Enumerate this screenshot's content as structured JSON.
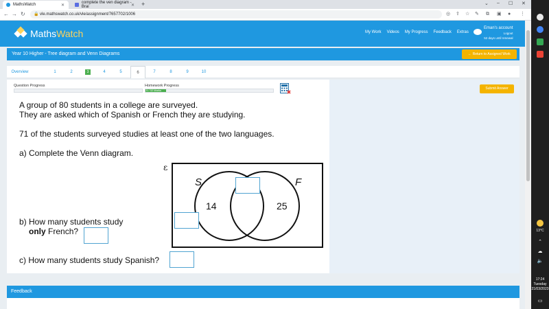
{
  "browser": {
    "tabs": [
      {
        "label": "MathsWatch",
        "active": true
      },
      {
        "label": "complete the ven diagram - Brai",
        "active": false
      }
    ],
    "url": "vle.mathswatch.co.uk/vle/assignment/7657702/1006"
  },
  "header": {
    "logo_maths": "Maths",
    "logo_watch": "Watch",
    "nav": [
      "My Work",
      "Videos",
      "My Progress",
      "Feedback",
      "Extras"
    ],
    "account_name": "Eman's account",
    "logout": "Logout",
    "days": "52 days until renewal"
  },
  "titlebar": {
    "title": "Year 10 Higher - Tree diagram and Venn Diagrams",
    "return_label": "← Return to Assigned Work"
  },
  "question_nav": {
    "overview": "Overview",
    "tabs": [
      "1",
      "2",
      "3",
      "4",
      "5",
      "6",
      "7",
      "8",
      "9",
      "10"
    ],
    "active_tab": "6",
    "completed_tab": "3"
  },
  "progress": {
    "question_label": "Question Progress",
    "homework_label": "Homework Progress",
    "homework_marks": "5 / 32 Marks",
    "homework_fraction": 0.16
  },
  "submit_label": "Submit Answer",
  "question": {
    "intro_line1": "A group of 80 students in a college are surveyed.",
    "intro_line2": "They are asked which of Spanish or French they are studying.",
    "intro_line3": "71 of the students surveyed studies at least one of the two languages.",
    "part_a": "a) Complete the Venn diagram.",
    "part_b_line1": "b) How many students study",
    "part_b_only": "only",
    "part_b_rest": "French?",
    "part_c": "c) How many students study Spanish?"
  },
  "venn": {
    "universal": "ε",
    "set_s": "S",
    "set_f": "F",
    "s_only": "14",
    "f_only": "25"
  },
  "feedback_title": "Feedback",
  "taskbar": {
    "temperature": "13°C",
    "time": "17:24",
    "day": "Tuesday",
    "date": "21/03/2023"
  }
}
